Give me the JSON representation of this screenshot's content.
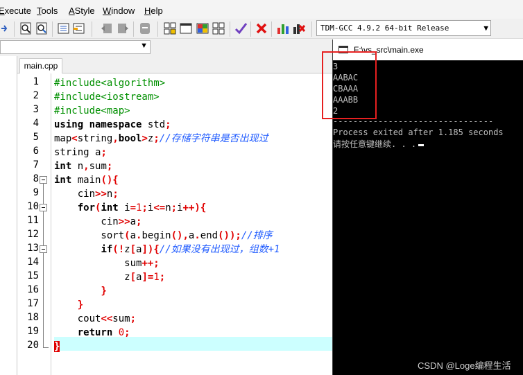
{
  "menu": {
    "items": [
      "xecute",
      "Tools",
      "AStyle",
      "Window",
      "Help"
    ],
    "mnemonics": [
      "E",
      "T",
      "A",
      "W",
      "H"
    ]
  },
  "toolbar": {
    "compiler_selected": "TDM-GCC 4.9.2 64-bit Release",
    "icons": [
      "indent-icon",
      "find-icon",
      "find-replace-icon",
      "insert-icon",
      "toggle-bookmark-icon",
      "back-icon",
      "forward-icon",
      "comment-icon",
      "class-browser-icon",
      "new-window-icon",
      "project-icon",
      "grid-icon",
      "check-icon",
      "close-icon",
      "chart-icon",
      "debug-icon"
    ]
  },
  "editor": {
    "tab_label": "main.cpp",
    "line_numbers": [
      "1",
      "2",
      "3",
      "4",
      "5",
      "6",
      "7",
      "8",
      "9",
      "10",
      "11",
      "12",
      "13",
      "14",
      "15",
      "16",
      "17",
      "18",
      "19",
      "20"
    ],
    "highlight_line": 20
  },
  "console": {
    "title": "F:\\vs_src\\main.exe",
    "lines": [
      "3",
      "AABAC",
      "CBAAA",
      "AAABB",
      "2",
      "--------------------------------",
      "Process exited after 1.185 seconds",
      "请按任意键继续. . ."
    ]
  },
  "watermark": "CSDN @Loge编程生活",
  "colors": {
    "preprocessor": "#009000",
    "symbol": "#e00000",
    "comment": "#1e5aff",
    "current_line": "#ccffff",
    "annotation_box": "#e62020"
  }
}
